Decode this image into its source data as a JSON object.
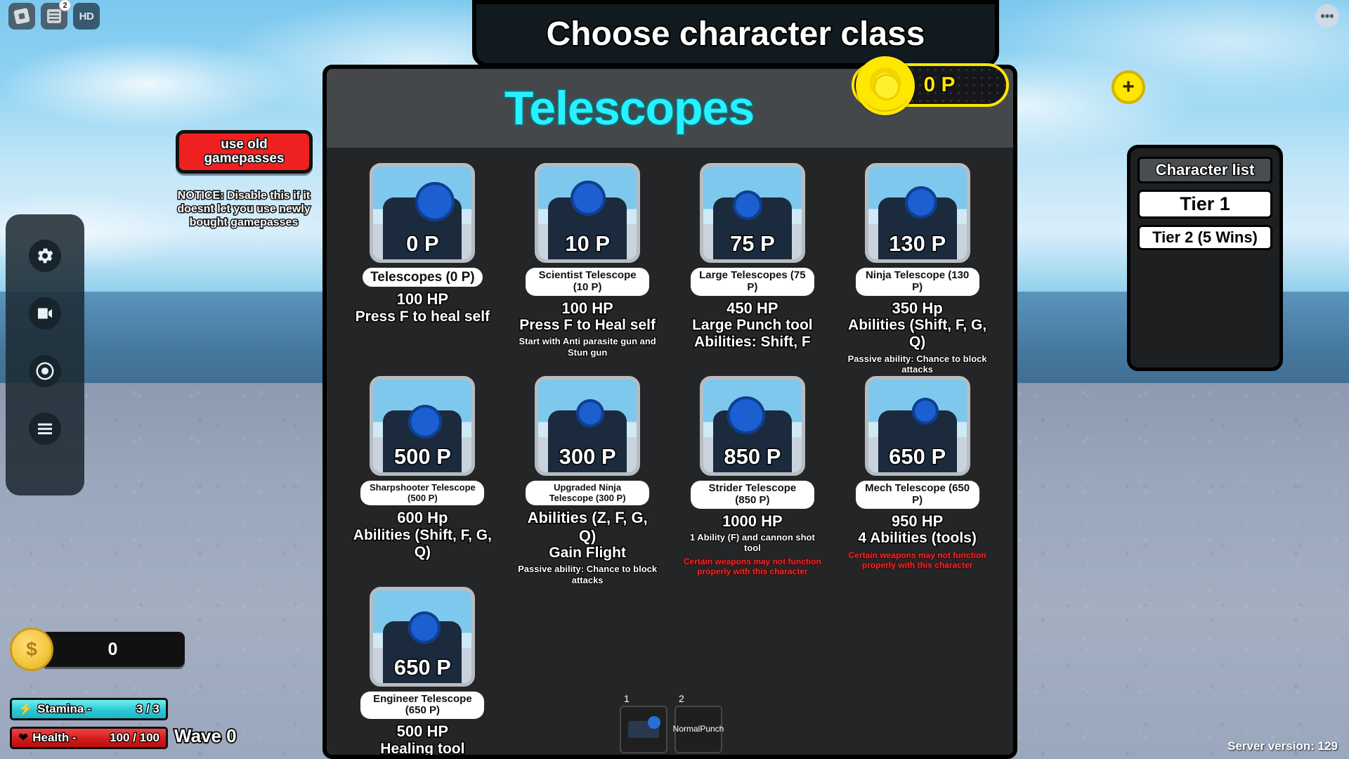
{
  "chrome": {
    "roblox_icon": "roblox-logo-icon",
    "chat_icon": "chat-icon",
    "chat_badge": "2",
    "hd_label": "HD",
    "more_icon": "ellipsis-icon"
  },
  "left_toolbar": {
    "items": [
      {
        "name": "settings",
        "icon": "gear-icon"
      },
      {
        "name": "recording",
        "icon": "video-icon"
      },
      {
        "name": "screenshot",
        "icon": "camera-icon"
      },
      {
        "name": "menu",
        "icon": "hamburger-icon"
      }
    ]
  },
  "gamepass": {
    "button_line1": "use old",
    "button_line2": "gamepasses",
    "notice": "NOTICE: Disable this if it doesnt let you use newly bought gamepasses"
  },
  "title_banner": {
    "text": "Choose character class"
  },
  "shop": {
    "header_title": "Telescopes",
    "currency": {
      "amount": "0 P",
      "coin_icon": "coin-icon",
      "plus_icon": "plus-icon"
    },
    "cards": [
      {
        "price_overlay": "0 P",
        "name": "Telescopes (0 P)",
        "hp": "100 HP",
        "lines": [
          "Press F to heal self"
        ],
        "small": [],
        "warning": ""
      },
      {
        "price_overlay": "10 P",
        "name": "Scientist Telescope (10 P)",
        "hp": "100 HP",
        "lines": [
          "Press F to Heal self"
        ],
        "small": [
          "Start with Anti parasite gun and Stun gun"
        ],
        "warning": ""
      },
      {
        "price_overlay": "75 P",
        "name": "Large Telescopes (75 P)",
        "hp": "450 HP",
        "lines": [
          "Large Punch tool",
          "Abilities: Shift,  F"
        ],
        "small": [],
        "warning": ""
      },
      {
        "price_overlay": "130 P",
        "name": "Ninja Telescope (130 P)",
        "hp": "350 Hp",
        "lines": [
          "Abilities (Shift, F, G, Q)"
        ],
        "small": [
          "Passive ability: Chance to block attacks"
        ],
        "warning": ""
      },
      {
        "price_overlay": "500 P",
        "name": "Sharpshooter Telescope (500 P)",
        "hp": "600  Hp",
        "lines": [
          "Abilities (Shift, F, G, Q)"
        ],
        "small": [],
        "warning": ""
      },
      {
        "price_overlay": "300 P",
        "name": "Upgraded Ninja Telescope (300 P)",
        "hp": "Abilities (Z, F, G, Q)",
        "lines": [
          "Gain Flight"
        ],
        "small": [
          "Passive ability: Chance to block attacks"
        ],
        "warning": ""
      },
      {
        "price_overlay": "850 P",
        "name": "Strider Telescope (850 P)",
        "hp": "1000 HP",
        "lines": [],
        "small": [
          "1 Ability (F) and cannon shot tool"
        ],
        "warning": "Certain weapons may not function properly with this character"
      },
      {
        "price_overlay": "650 P",
        "name": "Mech Telescope (650 P)",
        "hp": "950 HP",
        "lines": [
          "4 Abilities (tools)"
        ],
        "small": [],
        "warning": "Certain weapons may not function properly with this character"
      },
      {
        "price_overlay": "650 P",
        "name": "Engineer Telescope (650 P)",
        "hp": "500 HP",
        "lines": [
          "Healing tool"
        ],
        "small": [],
        "warning": ""
      }
    ]
  },
  "character_list": {
    "header": "Character list",
    "items": [
      {
        "label": "Tier 1"
      },
      {
        "label": "Tier 2 (5 Wins)"
      }
    ]
  },
  "hotbar": {
    "slots": [
      {
        "number": "1",
        "label": "",
        "icon": "gun-icon"
      },
      {
        "number": "2",
        "label": "NormalPunch",
        "icon": ""
      }
    ]
  },
  "hud": {
    "cash_icon": "coin-money-icon",
    "cash_value": "0",
    "stamina": {
      "icon": "lightning-icon",
      "label": "Stamina -",
      "value": "3 / 3",
      "fill_pct": 100
    },
    "health": {
      "icon": "heart-icon",
      "label": "Health -",
      "value": "100 / 100",
      "fill_pct": 100
    },
    "wave": "Wave 0"
  },
  "footer": {
    "server_version": "Server version: 129"
  }
}
